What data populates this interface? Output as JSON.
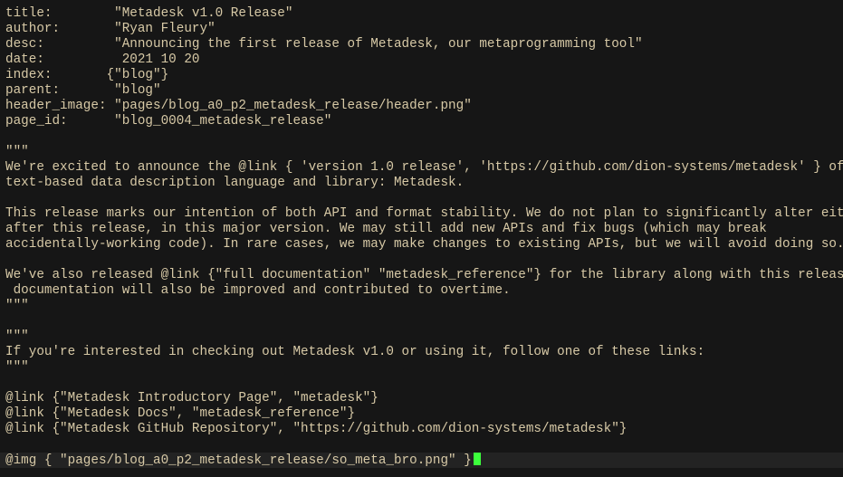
{
  "colors": {
    "background": "#161616",
    "text": "#d7c9a6",
    "current_line": "#232323",
    "cursor": "#3cff3c"
  },
  "lines": [
    "title:        \"Metadesk v1.0 Release\"",
    "author:       \"Ryan Fleury\"",
    "desc:         \"Announcing the first release of Metadesk, our metaprogramming tool\"",
    "date:          2021 10 20",
    "index:       {\"blog\"}",
    "parent:       \"blog\"",
    "header_image: \"pages/blog_a0_p2_metadesk_release/header.png\"",
    "page_id:      \"blog_0004_metadesk_release\"",
    "",
    "\"\"\"",
    "We're excited to announce the @link { 'version 1.0 release', 'https://github.com/dion-systems/metadesk' } of our",
    "text-based data description language and library: Metadesk.",
    "",
    "This release marks our intention of both API and format stability. We do not plan to significantly alter either",
    "after this release, in this major version. We may still add new APIs and fix bugs (which may break",
    "accidentally-working code). In rare cases, we may make changes to existing APIs, but we will avoid doing so.",
    "",
    "We've also released @link {\"full documentation\" \"metadesk_reference\"} for the library along with this release. This",
    " documentation will also be improved and contributed to overtime.",
    "\"\"\"",
    "",
    "\"\"\"",
    "If you're interested in checking out Metadesk v1.0 or using it, follow one of these links:",
    "\"\"\"",
    "",
    "@link {\"Metadesk Introductory Page\", \"metadesk\"}",
    "@link {\"Metadesk Docs\", \"metadesk_reference\"}",
    "@link {\"Metadesk GitHub Repository\", \"https://github.com/dion-systems/metadesk\"}",
    "",
    "@img { \"pages/blog_a0_p2_metadesk_release/so_meta_bro.png\" }"
  ]
}
